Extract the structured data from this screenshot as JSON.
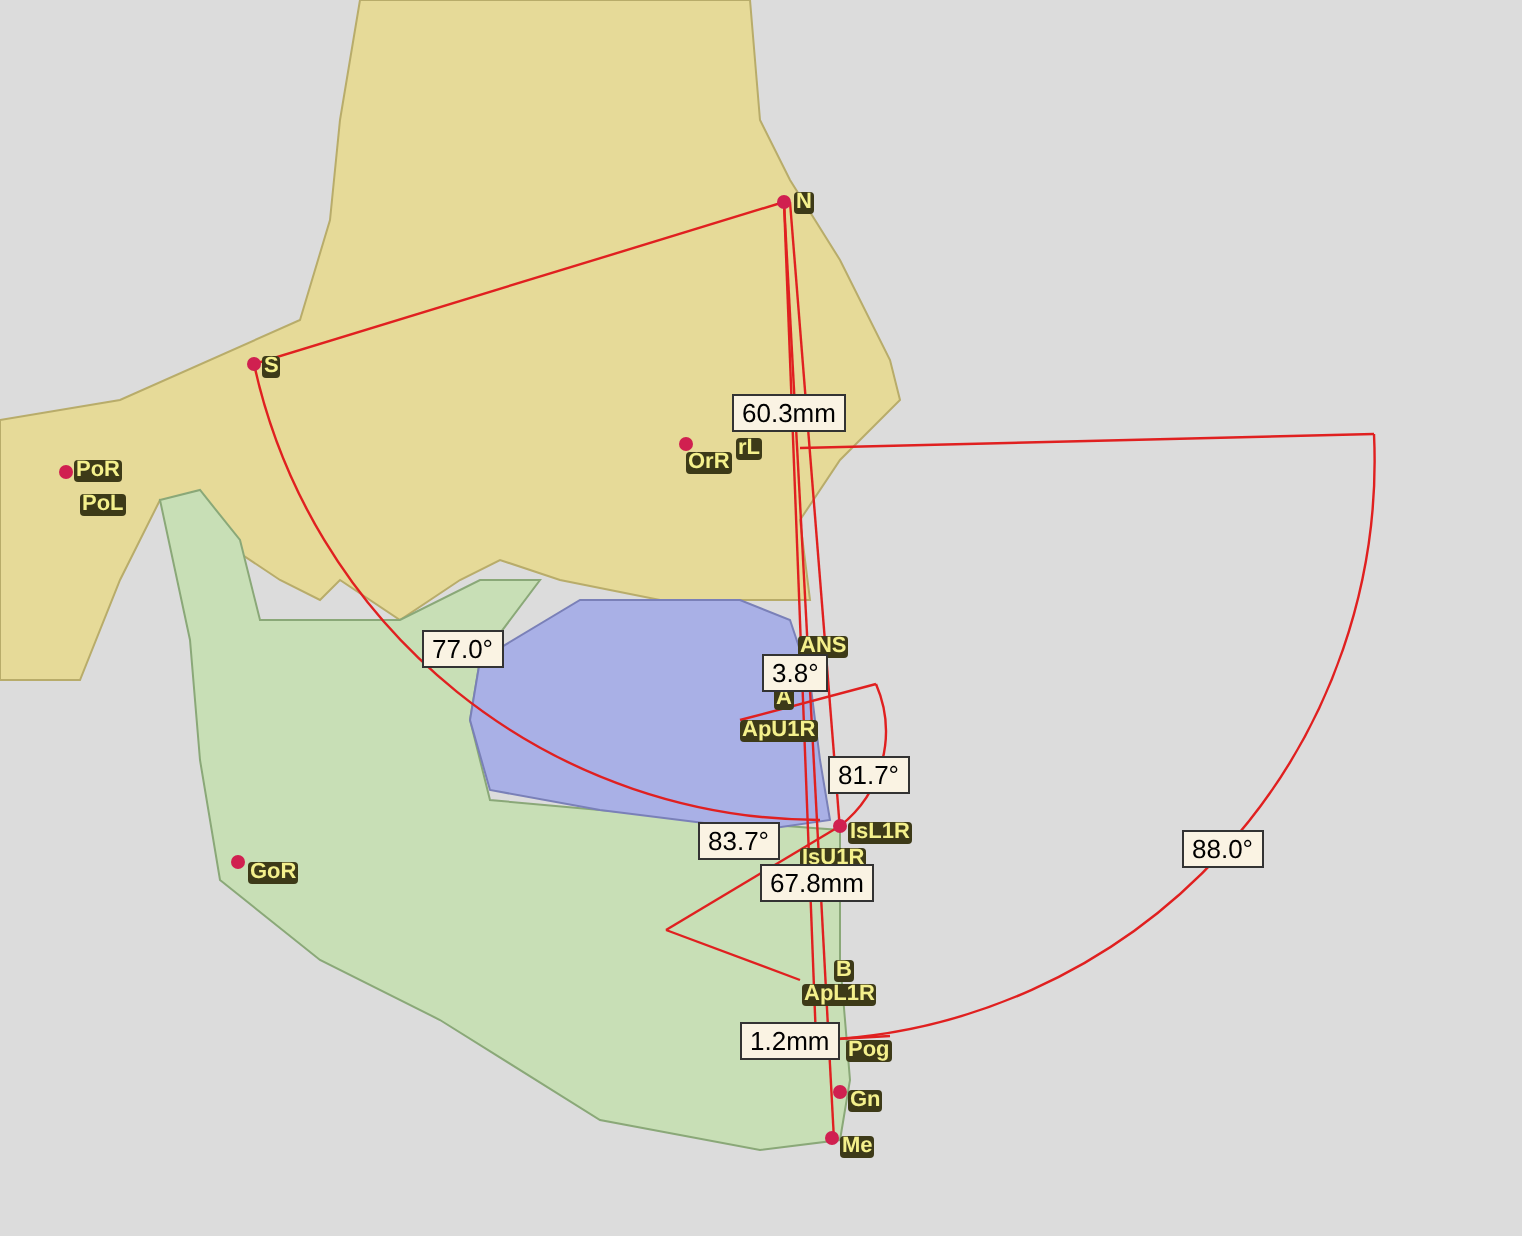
{
  "landmarks": [
    {
      "label": "N"
    },
    {
      "label": "S"
    },
    {
      "label": "OrR"
    },
    {
      "label": "rL"
    },
    {
      "label": "PoR"
    },
    {
      "label": "PoL"
    },
    {
      "label": "GoR"
    },
    {
      "label": "ANS"
    },
    {
      "label": "A"
    },
    {
      "label": "ApU1R"
    },
    {
      "label": "IsL1R"
    },
    {
      "label": "IsU1R"
    },
    {
      "label": "B"
    },
    {
      "label": "ApL1R"
    },
    {
      "label": "Pog"
    },
    {
      "label": "Gn"
    },
    {
      "label": "Me"
    }
  ],
  "measurements": [
    {
      "value": "60.3mm"
    },
    {
      "value": "77.0°"
    },
    {
      "value": "3.8°"
    },
    {
      "value": "81.7°"
    },
    {
      "value": "83.7°"
    },
    {
      "value": "67.8mm"
    },
    {
      "value": "1.2mm"
    },
    {
      "value": "88.0°"
    }
  ]
}
